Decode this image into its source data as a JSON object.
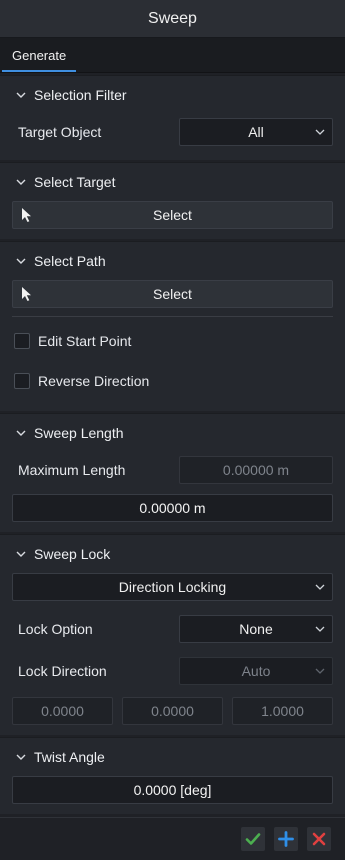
{
  "title": "Sweep",
  "tabs": [
    {
      "label": "Generate"
    }
  ],
  "selection_filter": {
    "header": "Selection Filter",
    "target_object_label": "Target Object",
    "target_object_value": "All"
  },
  "select_target": {
    "header": "Select Target",
    "button_label": "Select"
  },
  "select_path": {
    "header": "Select Path",
    "button_label": "Select",
    "edit_start_point_label": "Edit Start Point",
    "reverse_direction_label": "Reverse Direction"
  },
  "sweep_length": {
    "header": "Sweep Length",
    "max_length_label": "Maximum Length",
    "max_length_value": "0.00000 m",
    "length_value": "0.00000 m"
  },
  "sweep_lock": {
    "header": "Sweep Lock",
    "mode_value": "Direction Locking",
    "lock_option_label": "Lock Option",
    "lock_option_value": "None",
    "lock_direction_label": "Lock Direction",
    "lock_direction_value": "Auto",
    "vector": [
      "0.0000",
      "0.0000",
      "1.0000"
    ]
  },
  "twist_angle": {
    "header": "Twist Angle",
    "value": "0.0000 [deg]"
  },
  "colors": {
    "accept": "#4caf50",
    "add": "#2f8fe8",
    "cancel": "#e04040",
    "tab_underline": "#3f8fe0"
  },
  "icons": {
    "chevron": "chevron-down-icon",
    "cursor": "cursor-arrow-icon",
    "accept": "checkmark-icon",
    "add": "plus-icon",
    "cancel": "close-icon"
  }
}
